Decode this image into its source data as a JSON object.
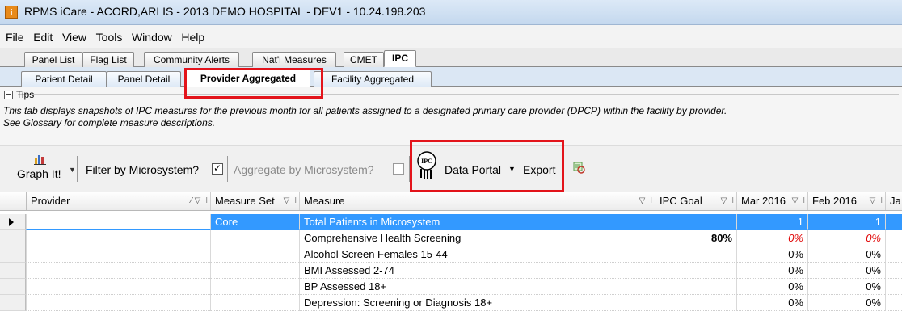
{
  "window": {
    "title": "RPMS iCare - ACORD,ARLIS - 2013 DEMO HOSPITAL - DEV1 - 10.24.198.203",
    "app_icon_letter": "i"
  },
  "menu": [
    "File",
    "Edit",
    "View",
    "Tools",
    "Window",
    "Help"
  ],
  "main_tabs": [
    "Panel List",
    "Flag List",
    "Community Alerts",
    "Nat'l Measures",
    "CMET",
    "IPC"
  ],
  "sub_tabs": [
    "Patient Detail",
    "Panel Detail",
    "Provider Aggregated",
    "Facility Aggregated"
  ],
  "tips": {
    "label": "Tips",
    "toggle": "−",
    "text_line1": "This tab displays snapshots of IPC measures for the previous month for all patients assigned to a designated primary care provider (DPCP) within the facility by provider.",
    "text_line2": "See Glossary for complete measure descriptions."
  },
  "toolbar": {
    "graph_label": "Graph It!",
    "filter_label": "Filter by Microsystem?",
    "filter_checked": "✓",
    "aggregate_label": "Aggregate by Microsystem?",
    "ipc_logo_text": "IPC",
    "data_portal_label": "Data Portal",
    "export_label": "Export"
  },
  "grid": {
    "columns": [
      "Provider",
      "Measure Set",
      "Measure",
      "IPC Goal",
      "Mar 2016",
      "Feb 2016",
      "Ja"
    ],
    "rows": [
      {
        "provider": "",
        "measure_set": "Core",
        "measure": "Total Patients in Microsystem",
        "goal": "",
        "mar": "1",
        "feb": "1"
      },
      {
        "provider": "",
        "measure_set": "",
        "measure": "Comprehensive Health Screening",
        "goal": "80%",
        "mar": "0%",
        "feb": "0%"
      },
      {
        "provider": "",
        "measure_set": "",
        "measure": "Alcohol Screen Females 15-44",
        "goal": "",
        "mar": "0%",
        "feb": "0%"
      },
      {
        "provider": "",
        "measure_set": "",
        "measure": "BMI Assessed 2-74",
        "goal": "",
        "mar": "0%",
        "feb": "0%"
      },
      {
        "provider": "",
        "measure_set": "",
        "measure": "BP Assessed 18+",
        "goal": "",
        "mar": "0%",
        "feb": "0%"
      },
      {
        "provider": "",
        "measure_set": "",
        "measure": "Depression: Screening or Diagnosis 18+",
        "goal": "",
        "mar": "0%",
        "feb": "0%"
      }
    ]
  },
  "colors": {
    "selection": "#3399ff",
    "highlight": "#e3141b",
    "below_goal": "#e00000"
  }
}
